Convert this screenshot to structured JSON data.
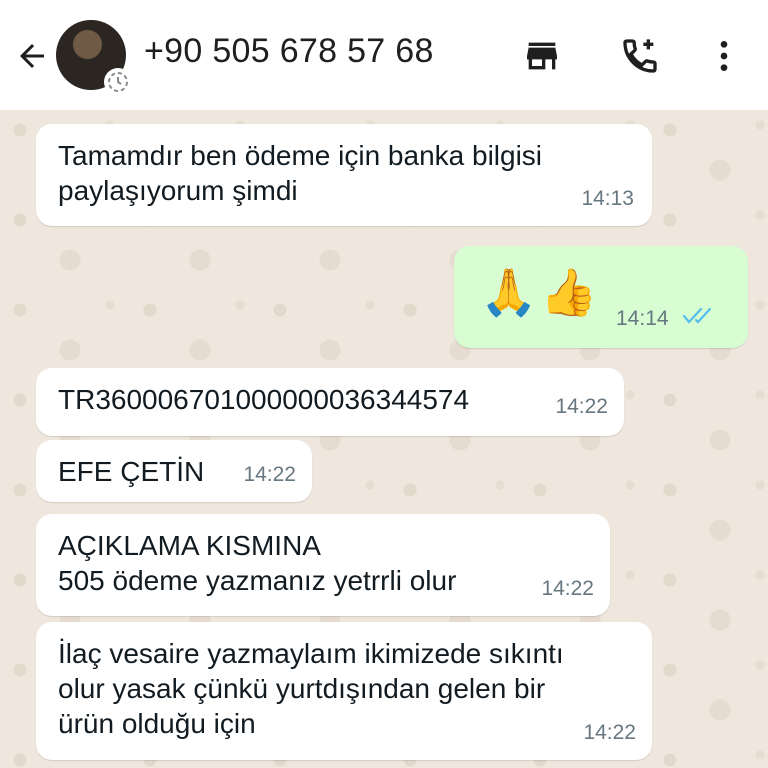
{
  "header": {
    "contact_name": "+90 505 678 57 68",
    "icons": [
      "back-arrow-icon",
      "avatar",
      "status-icon",
      "store-icon",
      "add-call-icon",
      "more-options-icon"
    ]
  },
  "messages": [
    {
      "direction": "in",
      "text": "Tamamdır ben ödeme için banka bilgisi\npaylaşıyorum şimdi",
      "time": "14:13"
    },
    {
      "direction": "out",
      "emojis": [
        "🙏",
        "👍"
      ],
      "time": "14:14",
      "status": "read"
    },
    {
      "direction": "in",
      "text": "TR360006701000000036344574",
      "time": "14:22"
    },
    {
      "direction": "in",
      "text": "EFE ÇETİN",
      "time": "14:22"
    },
    {
      "direction": "in",
      "text": "AÇIKLAMA KISMINA\n505 ödeme yazmanız yetrrli olur",
      "time": "14:22"
    },
    {
      "direction": "in",
      "text": "İlaç vesaire yazmaylaım ikimizede sıkıntı\nolur yasak çünkü yurtdışından gelen bir\nürün olduğu için",
      "time": "14:22"
    }
  ],
  "colors": {
    "incoming_bubble": "#ffffff",
    "outgoing_bubble": "#d9fdd3",
    "read_ticks": "#53bdeb",
    "timestamp": "#667781",
    "chat_background": "#efe7dd"
  }
}
